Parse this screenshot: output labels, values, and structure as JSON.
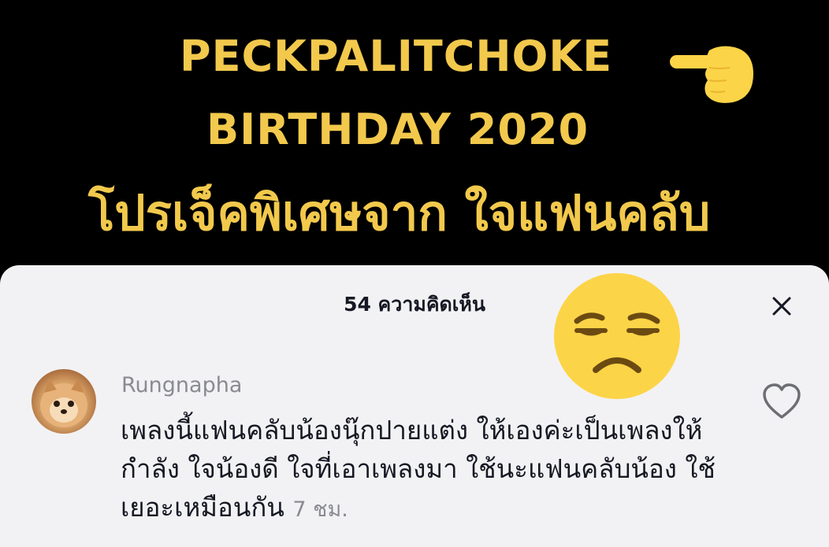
{
  "video": {
    "title_line1": "PECKPALITCHOKE",
    "title_line2": "BIRTHDAY 2020",
    "title_line3": "โปรเจ็คพิเศษจาก ใจแฟนคลับ",
    "accent_color": "#f2c94c",
    "pointing_icon": "pointing-hand-emoji"
  },
  "comments_panel": {
    "header_title": "54 ความคิดเห็น",
    "close_icon": "close-icon",
    "overlay_emoji": "unamused-face-emoji",
    "comments": [
      {
        "username": "Rungnapha",
        "avatar_icon": "pomeranian-dog-avatar",
        "text": "เพลงนี้แฟนคลับน้องนุ๊กปายแต่ง ให้เองค่ะเป็นเพลงให้กำลัง ใจน้องดี ใจที่เอาเพลงมา ใช้นะแฟนคลับน้อง ใช้เยอะเหมือนกัน",
        "time": "7 ชม.",
        "like_icon": "heart-outline-icon"
      }
    ]
  }
}
